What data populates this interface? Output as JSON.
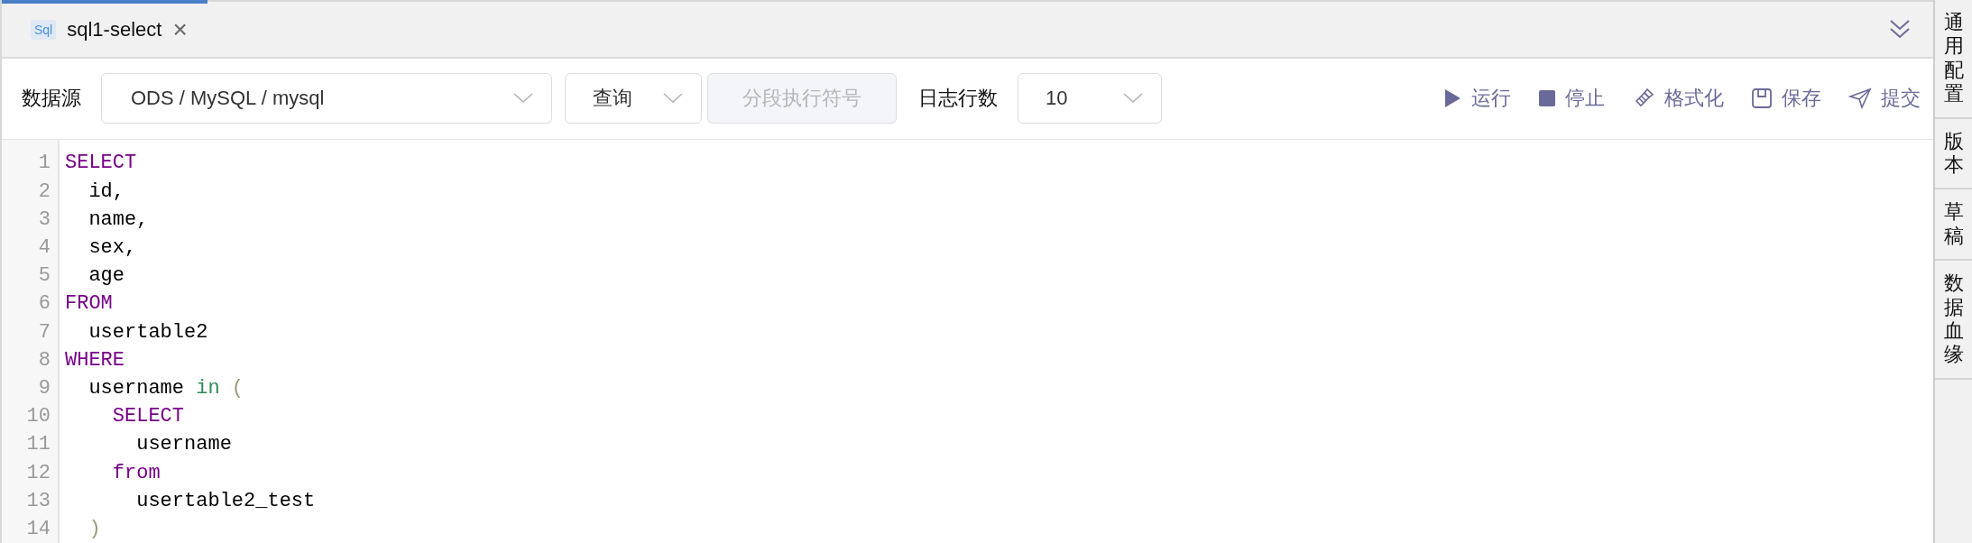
{
  "tabs": [
    {
      "icon_label": "Sql",
      "label": "sql1-select",
      "close": "×",
      "selected": true
    }
  ],
  "toolbar": {
    "datasource_label": "数据源",
    "datasource": "ODS / MySQL / mysql",
    "mode": "查询",
    "segment_button": {
      "label": "分段执行符号",
      "disabled": true
    },
    "log_rows_label": "日志行数",
    "log_rows": "10",
    "actions": [
      {
        "kind": "run",
        "label": "运行"
      },
      {
        "kind": "stop",
        "label": "停止"
      },
      {
        "kind": "format",
        "label": "格式化"
      },
      {
        "kind": "save",
        "label": "保存"
      },
      {
        "kind": "submit",
        "label": "提交"
      }
    ]
  },
  "editor": {
    "lines": [
      {
        "number": "1",
        "tokens": [
          {
            "kind": "keyword",
            "text": "SELECT"
          }
        ]
      },
      {
        "number": "2",
        "tokens": [
          {
            "kind": "plain",
            "text": "  id,"
          }
        ]
      },
      {
        "number": "3",
        "tokens": [
          {
            "kind": "plain",
            "text": "  name,"
          }
        ]
      },
      {
        "number": "4",
        "tokens": [
          {
            "kind": "plain",
            "text": "  sex,"
          }
        ]
      },
      {
        "number": "5",
        "tokens": [
          {
            "kind": "plain",
            "text": "  age"
          }
        ]
      },
      {
        "number": "6",
        "tokens": [
          {
            "kind": "keyword",
            "text": "FROM"
          }
        ]
      },
      {
        "number": "7",
        "tokens": [
          {
            "kind": "plain",
            "text": "  usertable2"
          }
        ]
      },
      {
        "number": "8",
        "tokens": [
          {
            "kind": "keyword",
            "text": "WHERE"
          }
        ]
      },
      {
        "number": "9",
        "tokens": [
          {
            "kind": "plain",
            "text": "  username "
          },
          {
            "kind": "operator",
            "text": "in"
          },
          {
            "kind": "bracket",
            "text": " ("
          }
        ]
      },
      {
        "number": "10",
        "tokens": [
          {
            "kind": "keyword",
            "text": "    SELECT"
          }
        ]
      },
      {
        "number": "11",
        "tokens": [
          {
            "kind": "plain",
            "text": "      username"
          }
        ]
      },
      {
        "number": "12",
        "tokens": [
          {
            "kind": "keyword",
            "text": "    from"
          }
        ]
      },
      {
        "number": "13",
        "tokens": [
          {
            "kind": "plain",
            "text": "      usertable2_test"
          }
        ]
      },
      {
        "number": "14",
        "tokens": [
          {
            "kind": "bracket",
            "text": "  )"
          }
        ]
      }
    ]
  },
  "side_panel": [
    {
      "label": "通用配置"
    },
    {
      "label": "版本"
    },
    {
      "label": "草稿"
    },
    {
      "label": "数据血缘"
    }
  ]
}
